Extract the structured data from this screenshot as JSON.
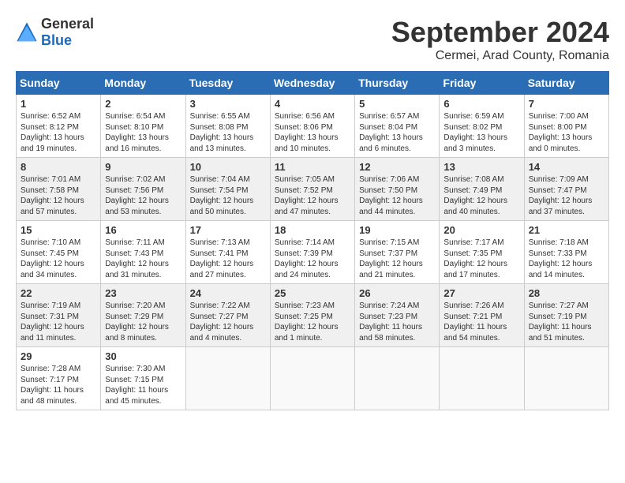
{
  "header": {
    "logo_general": "General",
    "logo_blue": "Blue",
    "month_year": "September 2024",
    "location": "Cermei, Arad County, Romania"
  },
  "weekdays": [
    "Sunday",
    "Monday",
    "Tuesday",
    "Wednesday",
    "Thursday",
    "Friday",
    "Saturday"
  ],
  "weeks": [
    [
      {
        "day": "1",
        "sunrise": "6:52 AM",
        "sunset": "8:12 PM",
        "daylight": "13 hours and 19 minutes."
      },
      {
        "day": "2",
        "sunrise": "6:54 AM",
        "sunset": "8:10 PM",
        "daylight": "13 hours and 16 minutes."
      },
      {
        "day": "3",
        "sunrise": "6:55 AM",
        "sunset": "8:08 PM",
        "daylight": "13 hours and 13 minutes."
      },
      {
        "day": "4",
        "sunrise": "6:56 AM",
        "sunset": "8:06 PM",
        "daylight": "13 hours and 10 minutes."
      },
      {
        "day": "5",
        "sunrise": "6:57 AM",
        "sunset": "8:04 PM",
        "daylight": "13 hours and 6 minutes."
      },
      {
        "day": "6",
        "sunrise": "6:59 AM",
        "sunset": "8:02 PM",
        "daylight": "13 hours and 3 minutes."
      },
      {
        "day": "7",
        "sunrise": "7:00 AM",
        "sunset": "8:00 PM",
        "daylight": "13 hours and 0 minutes."
      }
    ],
    [
      {
        "day": "8",
        "sunrise": "7:01 AM",
        "sunset": "7:58 PM",
        "daylight": "12 hours and 57 minutes."
      },
      {
        "day": "9",
        "sunrise": "7:02 AM",
        "sunset": "7:56 PM",
        "daylight": "12 hours and 53 minutes."
      },
      {
        "day": "10",
        "sunrise": "7:04 AM",
        "sunset": "7:54 PM",
        "daylight": "12 hours and 50 minutes."
      },
      {
        "day": "11",
        "sunrise": "7:05 AM",
        "sunset": "7:52 PM",
        "daylight": "12 hours and 47 minutes."
      },
      {
        "day": "12",
        "sunrise": "7:06 AM",
        "sunset": "7:50 PM",
        "daylight": "12 hours and 44 minutes."
      },
      {
        "day": "13",
        "sunrise": "7:08 AM",
        "sunset": "7:49 PM",
        "daylight": "12 hours and 40 minutes."
      },
      {
        "day": "14",
        "sunrise": "7:09 AM",
        "sunset": "7:47 PM",
        "daylight": "12 hours and 37 minutes."
      }
    ],
    [
      {
        "day": "15",
        "sunrise": "7:10 AM",
        "sunset": "7:45 PM",
        "daylight": "12 hours and 34 minutes."
      },
      {
        "day": "16",
        "sunrise": "7:11 AM",
        "sunset": "7:43 PM",
        "daylight": "12 hours and 31 minutes."
      },
      {
        "day": "17",
        "sunrise": "7:13 AM",
        "sunset": "7:41 PM",
        "daylight": "12 hours and 27 minutes."
      },
      {
        "day": "18",
        "sunrise": "7:14 AM",
        "sunset": "7:39 PM",
        "daylight": "12 hours and 24 minutes."
      },
      {
        "day": "19",
        "sunrise": "7:15 AM",
        "sunset": "7:37 PM",
        "daylight": "12 hours and 21 minutes."
      },
      {
        "day": "20",
        "sunrise": "7:17 AM",
        "sunset": "7:35 PM",
        "daylight": "12 hours and 17 minutes."
      },
      {
        "day": "21",
        "sunrise": "7:18 AM",
        "sunset": "7:33 PM",
        "daylight": "12 hours and 14 minutes."
      }
    ],
    [
      {
        "day": "22",
        "sunrise": "7:19 AM",
        "sunset": "7:31 PM",
        "daylight": "12 hours and 11 minutes."
      },
      {
        "day": "23",
        "sunrise": "7:20 AM",
        "sunset": "7:29 PM",
        "daylight": "12 hours and 8 minutes."
      },
      {
        "day": "24",
        "sunrise": "7:22 AM",
        "sunset": "7:27 PM",
        "daylight": "12 hours and 4 minutes."
      },
      {
        "day": "25",
        "sunrise": "7:23 AM",
        "sunset": "7:25 PM",
        "daylight": "12 hours and 1 minute."
      },
      {
        "day": "26",
        "sunrise": "7:24 AM",
        "sunset": "7:23 PM",
        "daylight": "11 hours and 58 minutes."
      },
      {
        "day": "27",
        "sunrise": "7:26 AM",
        "sunset": "7:21 PM",
        "daylight": "11 hours and 54 minutes."
      },
      {
        "day": "28",
        "sunrise": "7:27 AM",
        "sunset": "7:19 PM",
        "daylight": "11 hours and 51 minutes."
      }
    ],
    [
      {
        "day": "29",
        "sunrise": "7:28 AM",
        "sunset": "7:17 PM",
        "daylight": "11 hours and 48 minutes."
      },
      {
        "day": "30",
        "sunrise": "7:30 AM",
        "sunset": "7:15 PM",
        "daylight": "11 hours and 45 minutes."
      },
      null,
      null,
      null,
      null,
      null
    ]
  ]
}
